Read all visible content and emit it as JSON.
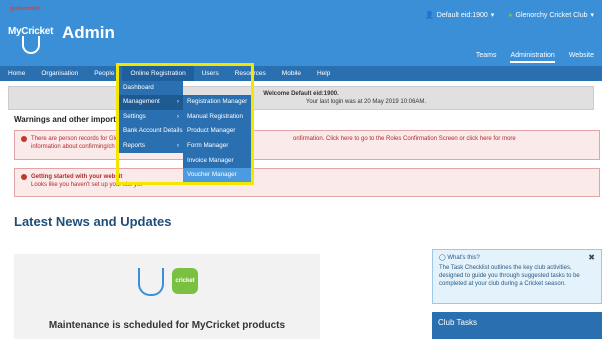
{
  "header": {
    "brand_top": "ignitecricket",
    "logo_text": "MyCricket",
    "title": "Admin",
    "user_label": "Default eid:1900",
    "club_label": "Glenorchy Cricket Club",
    "subnav": [
      "Teams",
      "Administration",
      "Website"
    ]
  },
  "mainnav": [
    "Home",
    "Organisation",
    "People",
    "Online Registration",
    "Users",
    "Resources",
    "Mobile",
    "Help"
  ],
  "dropdown": {
    "col1": [
      "Dashboard",
      "Management",
      "Settings",
      "Bank Account Details",
      "Reports"
    ],
    "col2": [
      "Registration Manager",
      "Manual Registration",
      "Product Manager",
      "Form Manager",
      "Invoice Manager",
      "Voucher Manager"
    ]
  },
  "welcome": {
    "line1": "Welcome Default eid:1900.",
    "line2": "Your last login was at 20 May 2019 10:06AM."
  },
  "warnings_title": "Warnings and other important",
  "alert1": {
    "text_left": "There are person records for Glen",
    "text_right": "onfirmation.   Click here to go to the Roles Confirmation Screen or click here for more",
    "text_line2": "information about confirming/ch"
  },
  "alert2": {
    "title": "Getting started with your websit",
    "text": "Looks like you haven't set up your site yet"
  },
  "news_title": "Latest News and Updates",
  "maintenance": {
    "badge": "cricket",
    "text": "Maintenance is scheduled for MyCricket products"
  },
  "sidebox": {
    "whats_this": "What's this?",
    "text": "The Task Checklist outlines the key club activities, designed to guide you through suggested tasks to be completed at your club during a Cricket season."
  },
  "tasks_title": "Club Tasks",
  "icons": {
    "user": "user-icon",
    "club": "club-icon",
    "arrow": "chevron-right-icon",
    "close": "close-icon"
  }
}
